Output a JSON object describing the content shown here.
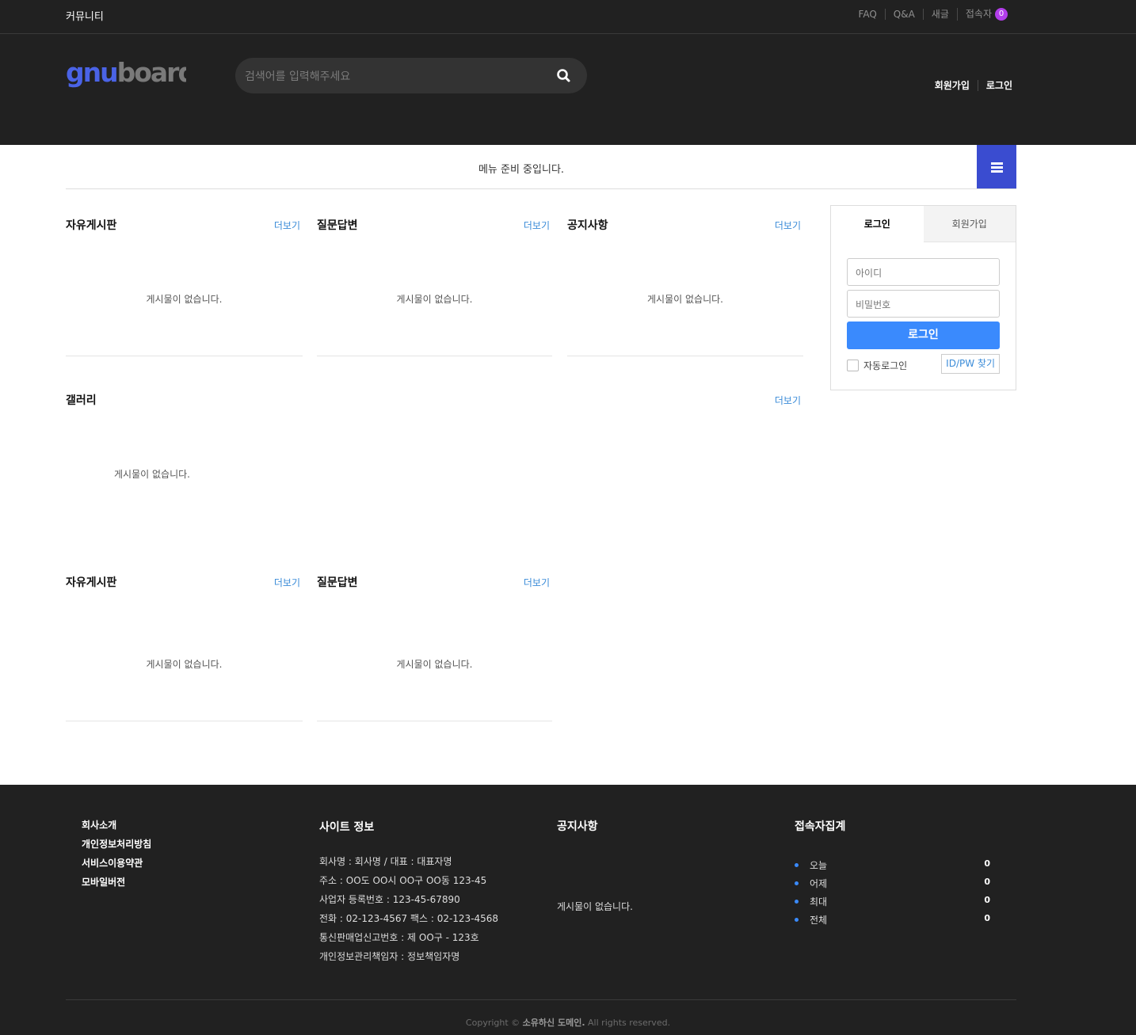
{
  "topbar": {
    "brand": "커뮤니티",
    "links": [
      "FAQ",
      "Q&A",
      "새글",
      "접속자"
    ],
    "visitor_badge": "0"
  },
  "header": {
    "logo_text_1": "gnu",
    "logo_text_2": "board",
    "search_placeholder": "검색어를 입력해주세요",
    "auth_links": [
      "회원가입",
      "로그인"
    ]
  },
  "menu": {
    "message": "메뉴 준비 중입니다."
  },
  "boards": [
    {
      "title": "자유게시판",
      "more": "더보기",
      "empty": "게시물이 없습니다."
    },
    {
      "title": "질문답변",
      "more": "더보기",
      "empty": "게시물이 없습니다."
    },
    {
      "title": "공지사항",
      "more": "더보기",
      "empty": "게시물이 없습니다."
    },
    {
      "title": "갤러리",
      "more": "더보기",
      "empty": "게시물이 없습니다."
    },
    {
      "title": "자유게시판",
      "more": "더보기",
      "empty": "게시물이 없습니다."
    },
    {
      "title": "질문답변",
      "more": "더보기",
      "empty": "게시물이 없습니다."
    }
  ],
  "login": {
    "tab_login": "로그인",
    "tab_join": "회원가입",
    "id_placeholder": "아이디",
    "pw_placeholder": "비밀번호",
    "submit": "로그인",
    "auto_login": "자동로그인",
    "find": "ID/PW 찾기"
  },
  "footer": {
    "links": [
      "회사소개",
      "개인정보처리방침",
      "서비스이용약관",
      "모바일버전"
    ],
    "site_info_title": "사이트 정보",
    "site_info": [
      "회사명 : 회사명 / 대표 : 대표자명",
      "주소 : OO도 OO시 OO구 OO동 123-45",
      "사업자 등록번호 : 123-45-67890",
      "전화 : 02-123-4567 팩스 : 02-123-4568",
      "통신판매업신고번호 : 제 OO구 - 123호",
      "개인정보관리책임자 : 정보책임자명"
    ],
    "notice_title": "공지사항",
    "notice_empty": "게시물이 없습니다.",
    "stats_title": "접속자집계",
    "stats": [
      {
        "label": "오늘",
        "value": "0"
      },
      {
        "label": "어제",
        "value": "0"
      },
      {
        "label": "최대",
        "value": "0"
      },
      {
        "label": "전체",
        "value": "0"
      }
    ],
    "copyright_pre": "Copyright ©",
    "copyright_domain": "소유하신 도메인.",
    "copyright_post": "All rights reserved."
  },
  "colors": {
    "dark_bg": "#212121",
    "accent_blue": "#3a8afd",
    "menu_button": "#3a4cd0",
    "badge_purple": "#b23dea",
    "more_link": "#3a8bd8"
  }
}
